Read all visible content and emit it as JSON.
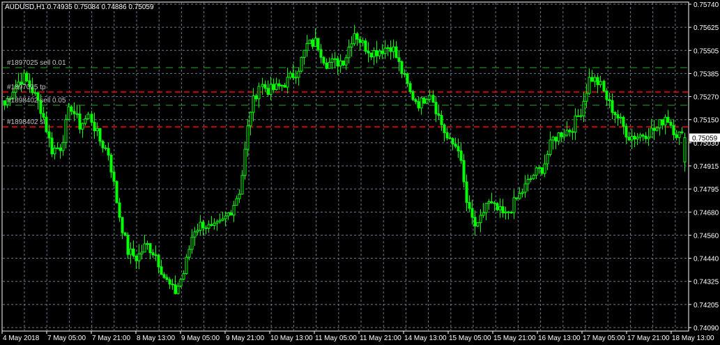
{
  "header": {
    "symbol_timeframe": "AUDUSD,H1",
    "open": "0.74935",
    "high": "0.75084",
    "low": "0.74886",
    "close": "0.75059"
  },
  "colors": {
    "background": "#000000",
    "candle": "#00ff00",
    "grid": "#6c7a89",
    "order_line": "#22aa22",
    "stop_line": "#ff0000",
    "text": "#ffffff"
  },
  "current_price": "0.75059",
  "orders": [
    {
      "label": "#1897025 sell 0.01",
      "price": 0.75416,
      "kind": "entry"
    },
    {
      "label": "#1897025 tp",
      "price": 0.75292,
      "kind": "stop"
    },
    {
      "label": "#1898402 sell 0.05",
      "price": 0.75224,
      "kind": "entry"
    },
    {
      "label": "#1898402 sl",
      "price": 0.75114,
      "kind": "stop"
    }
  ],
  "chart_data": {
    "type": "candlestick",
    "symbol": "AUDUSD",
    "timeframe": "H1",
    "ylim": [
      0.7409,
      0.7574
    ],
    "y_ticks": [
      "0.75740",
      "0.75625",
      "0.75505",
      "0.75385",
      "0.75270",
      "0.75150",
      "0.75030",
      "0.74915",
      "0.74795",
      "0.74680",
      "0.74560",
      "0.74440",
      "0.74325",
      "0.74205",
      "0.74090"
    ],
    "x_ticks": [
      "4 May 2018",
      "7 May 05:00",
      "7 May 21:00",
      "8 May 13:00",
      "9 May 05:00",
      "9 May 21:00",
      "10 May 13:00",
      "11 May 05:00",
      "11 May 21:00",
      "14 May 13:00",
      "15 May 05:00",
      "15 May 21:00",
      "16 May 13:00",
      "17 May 05:00",
      "17 May 21:00",
      "18 May 13:00"
    ],
    "candle_count": 244,
    "close_path": [
      0.75228,
      0.75316,
      0.7537,
      0.75299,
      0.75192,
      0.74996,
      0.75014,
      0.75228,
      0.75121,
      0.75174,
      0.75049,
      0.74978,
      0.74693,
      0.7448,
      0.74444,
      0.74515,
      0.74462,
      0.74337,
      0.74266,
      0.74373,
      0.74587,
      0.74622,
      0.74587,
      0.74622,
      0.74693,
      0.748,
      0.75192,
      0.75334,
      0.75299,
      0.75316,
      0.75352,
      0.75405,
      0.7553,
      0.75548,
      0.75441,
      0.75441,
      0.75459,
      0.75601,
      0.7553,
      0.75494,
      0.75512,
      0.7553,
      0.75405,
      0.75281,
      0.75228,
      0.75299,
      0.75156,
      0.75032,
      0.75014,
      0.74693,
      0.74587,
      0.74729,
      0.74693,
      0.74658,
      0.74729,
      0.748,
      0.74871,
      0.74907,
      0.75049,
      0.75085,
      0.75103,
      0.75192,
      0.7537,
      0.75334,
      0.75228,
      0.75156,
      0.75067,
      0.75067,
      0.75085,
      0.75103,
      0.75174,
      0.75085,
      0.75059
    ]
  }
}
